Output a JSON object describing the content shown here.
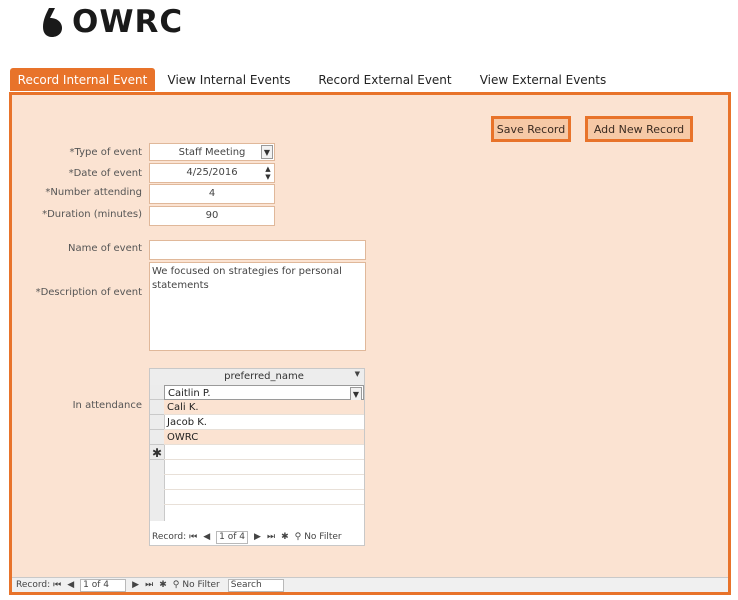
{
  "logo": {
    "text": "OWRC"
  },
  "tabs": [
    {
      "label": "Record Internal Event"
    },
    {
      "label": "View Internal Events"
    },
    {
      "label": "Record External Event"
    },
    {
      "label": "View External Events"
    }
  ],
  "actions": {
    "save": "Save Record",
    "add": "Add New Record"
  },
  "form": {
    "type_label": "*Type of event",
    "type_value": "Staff Meeting",
    "date_label": "*Date of event",
    "date_value": "4/25/2016",
    "number_label": "*Number attending",
    "number_value": "4",
    "duration_label": "*Duration (minutes)",
    "duration_value": "90",
    "name_label": "Name of event",
    "name_value": "",
    "desc_label": "*Description of event",
    "desc_value": "We focused on strategies for personal statements",
    "attendance_label": "In attendance"
  },
  "subform": {
    "column": "preferred_name",
    "rows": [
      "Caitlin P.",
      "Cali K.",
      "Jacob K.",
      "OWRC"
    ],
    "new_row_marker": "✱",
    "nav": {
      "record_label": "Record:",
      "position": "1 of 4",
      "filter": "No Filter"
    }
  },
  "main_nav": {
    "record_label": "Record:",
    "position": "1 of 4",
    "filter": "No Filter",
    "search": "Search"
  },
  "colors": {
    "accent": "#e8732a",
    "form_bg": "#fbe3d2",
    "button_bg": "#f6c9a6"
  }
}
